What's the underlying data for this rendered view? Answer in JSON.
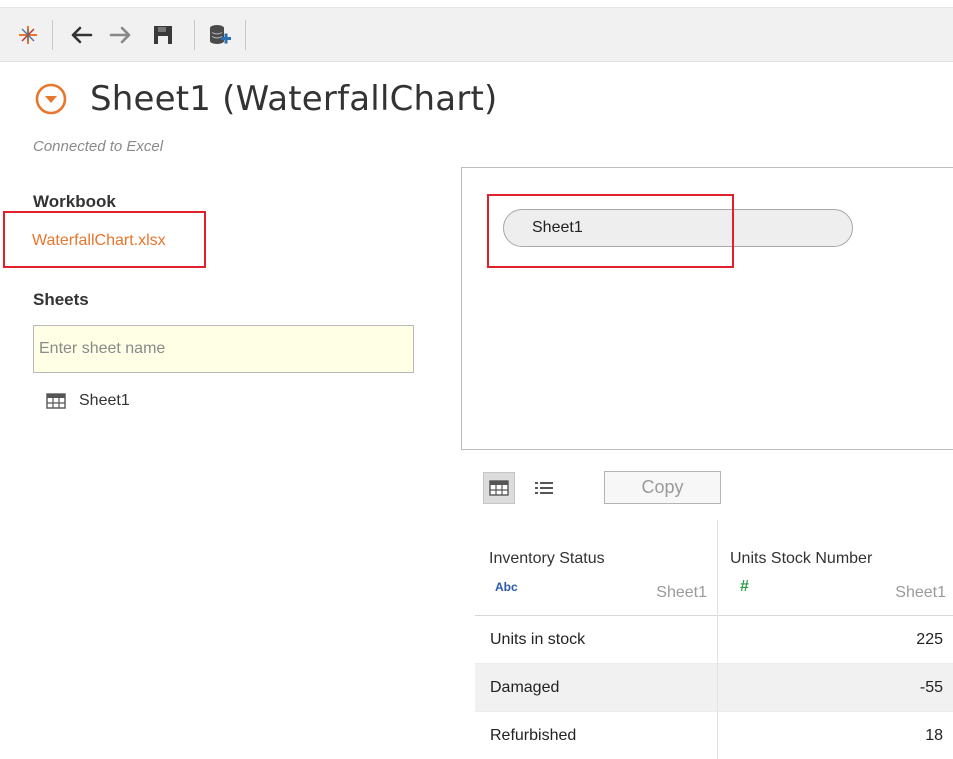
{
  "toolbar": {
    "icons": [
      "tableau-logo-icon",
      "back-arrow-icon",
      "forward-arrow-icon",
      "save-icon",
      "new-data-source-icon"
    ]
  },
  "header": {
    "title": "Sheet1 (WaterfallChart)",
    "connection_status": "Connected to Excel"
  },
  "sidebar": {
    "workbook_label": "Workbook",
    "workbook_file": "WaterfallChart.xlsx",
    "sheets_label": "Sheets",
    "sheet_search_placeholder": "Enter sheet name",
    "sheets": [
      {
        "name": "Sheet1"
      }
    ]
  },
  "canvas": {
    "table_pill": "Sheet1"
  },
  "grid": {
    "copy_label": "Copy",
    "columns": [
      {
        "name": "Inventory Status",
        "type_icon": "Abc",
        "source": "Sheet1"
      },
      {
        "name": "Units Stock Number",
        "type_icon": "#",
        "source": "Sheet1"
      }
    ],
    "rows": [
      {
        "status": "Units in stock",
        "units": "225"
      },
      {
        "status": "Damaged",
        "units": "-55"
      },
      {
        "status": "Refurbished",
        "units": "18"
      }
    ]
  },
  "colors": {
    "accent_orange": "#e8762d",
    "highlight_red": "#e0202a",
    "input_bg": "#ffffe6",
    "string_type_blue": "#2a5ba8",
    "number_type_green": "#2e9b4a"
  }
}
